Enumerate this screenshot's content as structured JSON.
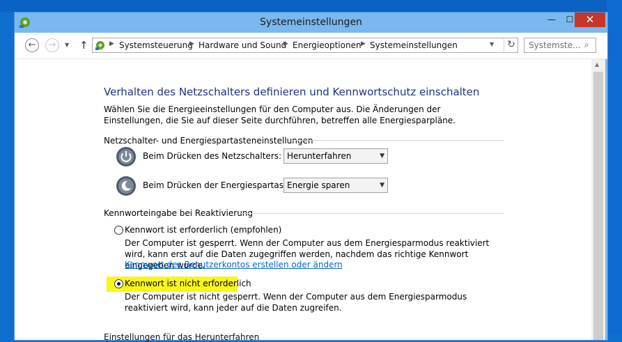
{
  "window": {
    "title": "Systemeinstellungen"
  },
  "nav": {
    "breadcrumb": [
      "Systemsteuerung",
      "Hardware und Sound",
      "Energieoptionen",
      "Systemeinstellungen"
    ],
    "search_placeholder": "Systemste..."
  },
  "page": {
    "heading": "Verhalten des Netzschalters definieren und Kennwortschutz einschalten",
    "intro": "Wählen Sie die Energieeinstellungen für den Computer aus. Die Änderungen der Einstellungen, die Sie auf dieser Seite durchführen, betreffen alle Energiesparpläne.",
    "power_group": {
      "title": "Netzschalter- und Energiespartasteneinstellungen",
      "rows": [
        {
          "label": "Beim Drücken des Netzschalters:",
          "value": "Herunterfahren",
          "icon": "power-icon"
        },
        {
          "label": "Beim Drücken der Energiespartaste:",
          "value": "Energie sparen",
          "icon": "sleep-icon"
        }
      ]
    },
    "password_group": {
      "title": "Kennworteingabe bei Reaktivierung",
      "options": [
        {
          "label": "Kennwort ist erforderlich (empfohlen)",
          "description": "Der Computer ist gesperrt. Wenn der Computer aus dem Energiesparmodus reaktiviert wird, kann erst auf die Daten zugegriffen werden, nachdem das richtige Kennwort eingegeben wurde.",
          "link": "Kennwort des Benutzerkontos erstellen oder ändern",
          "selected": false
        },
        {
          "label": "Kennwort ist nicht erforderlich",
          "description": "Der Computer ist nicht gesperrt. Wenn der Computer aus dem Energiesparmodus reaktiviert wird, kann jeder auf die Daten zugreifen.",
          "selected": true
        }
      ]
    },
    "cutoff_text": "Einstellungen für das Herunterfahren"
  },
  "colors": {
    "heading": "#1e3287",
    "link": "#0066cc",
    "highlight": "#f7f71a",
    "titlebar": "#7ab8ef",
    "close": "#c7362b"
  }
}
